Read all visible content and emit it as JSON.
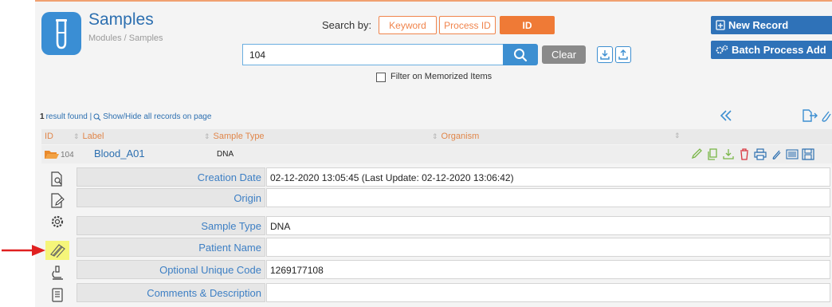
{
  "module": {
    "title": "Samples",
    "breadcrumb": "Modules / Samples"
  },
  "search": {
    "label": "Search by:",
    "modes": [
      "Keyword",
      "Process ID",
      "ID"
    ],
    "active_mode": "ID",
    "value": "104",
    "clear_label": "Clear",
    "filter_label": "Filter on Memorized Items",
    "filter_checked": false
  },
  "actions": {
    "new_record": "New Record",
    "batch_process_add": "Batch Process Add"
  },
  "results": {
    "count": "1",
    "summary": "result found |",
    "toggle_link": "Show/Hide all records on page"
  },
  "table": {
    "columns": [
      "ID",
      "Label",
      "Sample Type",
      "Organism"
    ],
    "rows": [
      {
        "id": "104",
        "label": "Blood_A01",
        "sample_type": "DNA",
        "organism": ""
      }
    ],
    "row_action_icons": [
      "edit-icon",
      "copy-icon",
      "download-icon",
      "delete-icon",
      "print-icon",
      "attach-icon",
      "barcode-icon",
      "save-icon"
    ]
  },
  "sidebar_icons": [
    "view-details-icon",
    "edit-document-icon",
    "settings-icon",
    "test-tubes-icon",
    "microscope-icon",
    "notebook-icon"
  ],
  "details": [
    {
      "label": "Creation Date",
      "value": "02-12-2020 13:05:45 (Last Update: 02-12-2020 13:06:42)"
    },
    {
      "label": "Origin",
      "value": ""
    },
    {
      "label": "Sample Type",
      "value": "DNA"
    },
    {
      "label": "Patient Name",
      "value": ""
    },
    {
      "label": "Optional Unique Code",
      "value": "1269177108"
    },
    {
      "label": "Comments & Description",
      "value": ""
    }
  ],
  "colors": {
    "accent_orange": "#ef7a36",
    "primary_blue": "#2f72b8",
    "link_blue": "#2c6fb0",
    "icon_green": "#7ab648",
    "highlight_yellow": "#f5f57a",
    "arrow_red": "#e02020"
  }
}
